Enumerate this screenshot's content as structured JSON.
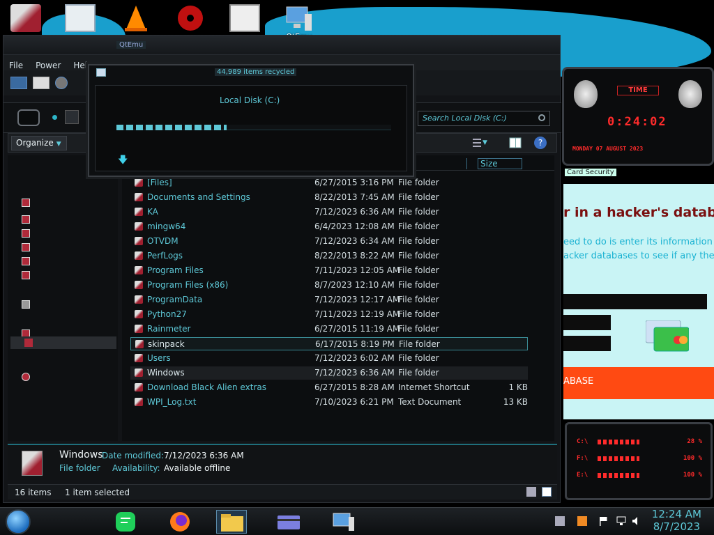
{
  "desktop": {
    "icons": [
      {
        "name": "unknown-app-icon",
        "label": ""
      },
      {
        "name": "window-doc-icon",
        "label": ""
      },
      {
        "name": "vlc-cone-icon",
        "label": ""
      },
      {
        "name": "radiation-icon",
        "label": ""
      },
      {
        "name": "maze-app-icon",
        "label": ""
      },
      {
        "name": "qtemu-icon",
        "label": "QtEmu"
      }
    ]
  },
  "explorer": {
    "title": "QtEmu",
    "menu": [
      "File",
      "Power",
      "Hel"
    ],
    "search_placeholder": "Search Local Disk (C:)",
    "organize_label": "Organize",
    "columns": {
      "size": "Size"
    },
    "files": [
      {
        "name": "[Files]",
        "date": "6/27/2015 3:16 PM",
        "type": "File folder",
        "size": ""
      },
      {
        "name": "Documents and Settings",
        "date": "8/22/2013 7:45 AM",
        "type": "File folder",
        "size": ""
      },
      {
        "name": "KA",
        "date": "7/12/2023 6:36 AM",
        "type": "File folder",
        "size": ""
      },
      {
        "name": "mingw64",
        "date": "6/4/2023 12:08 AM",
        "type": "File folder",
        "size": ""
      },
      {
        "name": "OTVDM",
        "date": "7/12/2023 6:34 AM",
        "type": "File folder",
        "size": ""
      },
      {
        "name": "PerfLogs",
        "date": "8/22/2013 8:22 AM",
        "type": "File folder",
        "size": ""
      },
      {
        "name": "Program Files",
        "date": "7/11/2023 12:05 AM",
        "type": "File folder",
        "size": ""
      },
      {
        "name": "Program Files (x86)",
        "date": "8/7/2023 12:10 AM",
        "type": "File folder",
        "size": ""
      },
      {
        "name": "ProgramData",
        "date": "7/12/2023 12:17 AM",
        "type": "File folder",
        "size": ""
      },
      {
        "name": "Python27",
        "date": "7/11/2023 12:19 AM",
        "type": "File folder",
        "size": ""
      },
      {
        "name": "Rainmeter",
        "date": "6/27/2015 11:19 AM",
        "type": "File folder",
        "size": ""
      },
      {
        "name": "skinpack",
        "date": "6/17/2015 8:19 PM",
        "type": "File folder",
        "size": ""
      },
      {
        "name": "Users",
        "date": "7/12/2023 6:02 AM",
        "type": "File folder",
        "size": ""
      },
      {
        "name": "Windows",
        "date": "7/12/2023 6:36 AM",
        "type": "File folder",
        "size": ""
      },
      {
        "name": "Download Black Alien extras",
        "date": "6/27/2015 8:28 AM",
        "type": "Internet Shortcut",
        "size": "1 KB"
      },
      {
        "name": "WPI_Log.txt",
        "date": "7/10/2023 6:21 PM",
        "type": "Text Document",
        "size": "13 KB"
      }
    ],
    "details": {
      "name": "Windows",
      "type": "File folder",
      "modified_key": "Date modified:",
      "modified_val": "7/12/2023 6:36 AM",
      "avail_key": "Availability:",
      "avail_val": "Available offline"
    },
    "status": {
      "items": "16 items",
      "selected": "1 item selected"
    }
  },
  "dialog": {
    "title": "44,989 items recycled",
    "destination": "Local Disk (C:)",
    "progress": 0.4
  },
  "clock_widget": {
    "label": "TIME",
    "time": "0:24:02",
    "date": "MONDAY 07 AUGUST 2023"
  },
  "browser": {
    "tab": "Card Security",
    "heading": "r in a hacker's database",
    "text_lines": [
      "eed to do is enter its information",
      "acker databases to see if any they"
    ],
    "button": "ABASE"
  },
  "meter_widget": {
    "rows": [
      {
        "label": "C:\\",
        "value": "28 %"
      },
      {
        "label": "F:\\",
        "value": "100 %"
      },
      {
        "label": "E:\\",
        "value": "100 %"
      }
    ]
  },
  "taskbar": {
    "time": "12:24 AM",
    "date": "8/7/2023"
  }
}
